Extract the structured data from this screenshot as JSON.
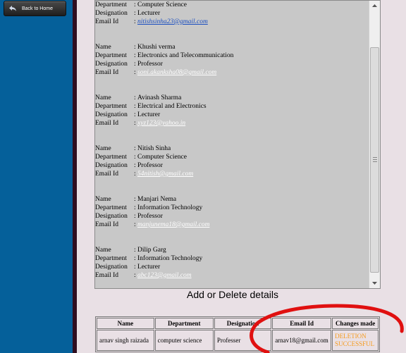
{
  "sidebar": {
    "back_button": "Back to Home"
  },
  "records": [
    {
      "name": "",
      "department": "Computer Science",
      "designation": "Lecturer",
      "email": "nitishsinha23@gmail.com"
    },
    {
      "name": "Khushi verma",
      "department": "Electronics and Telecommunication",
      "designation": "Professor",
      "email": "soni.akanksha08@gmail.com"
    },
    {
      "name": "Avinash Sharma",
      "department": "Electrical and Electronics",
      "designation": "Lecturer",
      "email": "xyz123@yahoo.in"
    },
    {
      "name": "Nitish Sinha",
      "department": "Computer Science",
      "designation": "Professor",
      "email": "54nitish@gmail.com"
    },
    {
      "name": "Manjari Nema",
      "department": "Information Technology",
      "designation": "Professor",
      "email": "manjunema18@gmail.com"
    },
    {
      "name": "Dilip Garg",
      "department": "Information Technology",
      "designation": "Lecturer",
      "email": "abc123@gmail.com"
    }
  ],
  "labels": {
    "name": "Name",
    "department": "Department",
    "designation": "Designation",
    "email": "Email Id"
  },
  "section_title": "Add or Delete details",
  "table": {
    "headers": [
      "Name",
      "Department",
      "Designation",
      "Email Id",
      "Changes made"
    ],
    "rows": [
      [
        "arnav singh raizada",
        "computer science",
        "Professer",
        "arnav18@gmail.com",
        "DELETION SUCCESSFUL"
      ]
    ]
  },
  "colors": {
    "sidebar": "#05609a",
    "annotation": "#e01010",
    "status": "#f59a1c",
    "link": "#1a4ec0"
  }
}
